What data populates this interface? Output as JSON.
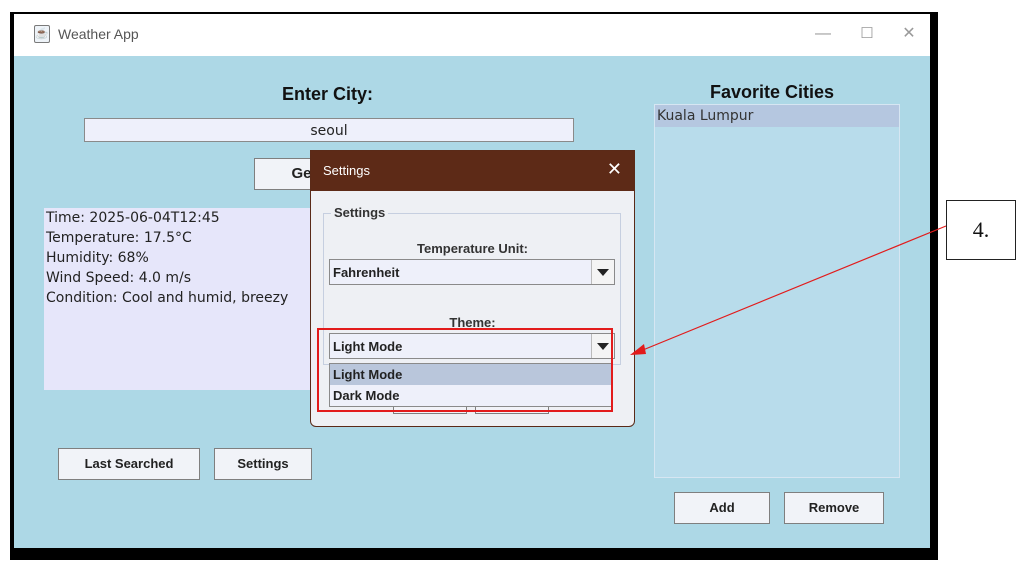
{
  "window": {
    "title": "Weather App",
    "app_icon": "java-cup-icon",
    "controls": {
      "minimize": "—",
      "maximize": "☐",
      "close": "✕"
    }
  },
  "main": {
    "city_label": "Enter City:",
    "city_value": "seoul",
    "get_button": "Get",
    "weather": {
      "time": "Time: 2025-06-04T12:45",
      "temperature": "Temperature: 17.5°C",
      "humidity": "Humidity: 68%",
      "wind": "Wind Speed: 4.0 m/s",
      "condition": "Condition: Cool and humid, breezy"
    },
    "last_searched_button": "Last Searched",
    "settings_button": "Settings"
  },
  "favorites": {
    "title": "Favorite Cities",
    "items": [
      "Kuala Lumpur"
    ],
    "add_button": "Add",
    "remove_button": "Remove"
  },
  "settings_dialog": {
    "title": "Settings",
    "group_label": "Settings",
    "temp_unit_label": "Temperature Unit:",
    "temp_unit_value": "Fahrenheit",
    "theme_label": "Theme:",
    "theme_value": "Light Mode",
    "theme_options": [
      "Light Mode",
      "Dark Mode"
    ]
  },
  "annotation": {
    "label": "4.",
    "color": "#e21b1b"
  }
}
